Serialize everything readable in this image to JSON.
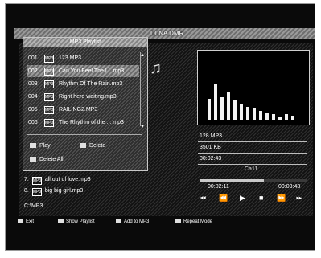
{
  "title": "DLNA DMR",
  "playlist": {
    "header": "MP3 Playlist",
    "items": [
      {
        "num": "001",
        "icon": "MP3",
        "name": "123.MP3"
      },
      {
        "num": "002",
        "icon": "MP3",
        "name": "Can You Feel The L...mp3"
      },
      {
        "num": "003",
        "icon": "MP3",
        "name": "Rhythm Of The Rain.mp3"
      },
      {
        "num": "004",
        "icon": "MP3",
        "name": "Right here waiting.mp3"
      },
      {
        "num": "005",
        "icon": "MP3",
        "name": "RAILING2.MP3"
      },
      {
        "num": "006",
        "icon": "MP3",
        "name": "The Rhythm of the ... mp3"
      }
    ],
    "play_label": "Play",
    "delete_label": "Delete",
    "delete_all_label": "Delete All"
  },
  "file_list": {
    "items": [
      {
        "num": "7.",
        "icon": "MP3",
        "name": "all out of love.mp3"
      },
      {
        "num": "8.",
        "icon": "MP3",
        "name": "big big girl.mp3"
      }
    ],
    "path": "C:\\MP3"
  },
  "info": {
    "bitrate": "128 MP3",
    "size": "3501 KB",
    "duration": "00:02:43",
    "status": "Ca11",
    "current_time": "00:02:11",
    "total_time": "00:03:43",
    "progress": 0.6
  },
  "spectrum_levels": [
    0.32,
    0.55,
    0.34,
    0.42,
    0.3,
    0.24,
    0.2,
    0.18,
    0.14,
    0.1,
    0.08,
    0.05,
    0.08,
    0.06
  ],
  "controls": {
    "prev": "⏮",
    "rewind": "⏪",
    "play": "▶",
    "stop": "■",
    "fast_forward": "⏩",
    "next": "⏭"
  },
  "footer": {
    "exit": "Exit",
    "show_playlist": "Show Playlist",
    "add_to_mp3": "Add to MP3",
    "repeat_mode": "Repeat Mode"
  }
}
